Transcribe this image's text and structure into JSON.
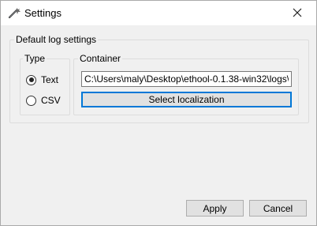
{
  "window": {
    "title": "Settings"
  },
  "group": {
    "label": "Default log settings"
  },
  "type_group": {
    "label": "Type",
    "options": [
      {
        "label": "Text",
        "checked": true
      },
      {
        "label": "CSV",
        "checked": false
      }
    ]
  },
  "container_group": {
    "label": "Container",
    "path_value": "C:\\Users\\maly\\Desktop\\ethool-0.1.38-win32\\logs\\",
    "select_button": "Select localization"
  },
  "footer": {
    "apply": "Apply",
    "cancel": "Cancel"
  },
  "icons": {
    "title": "settings-wand-icon",
    "close": "close-icon"
  }
}
